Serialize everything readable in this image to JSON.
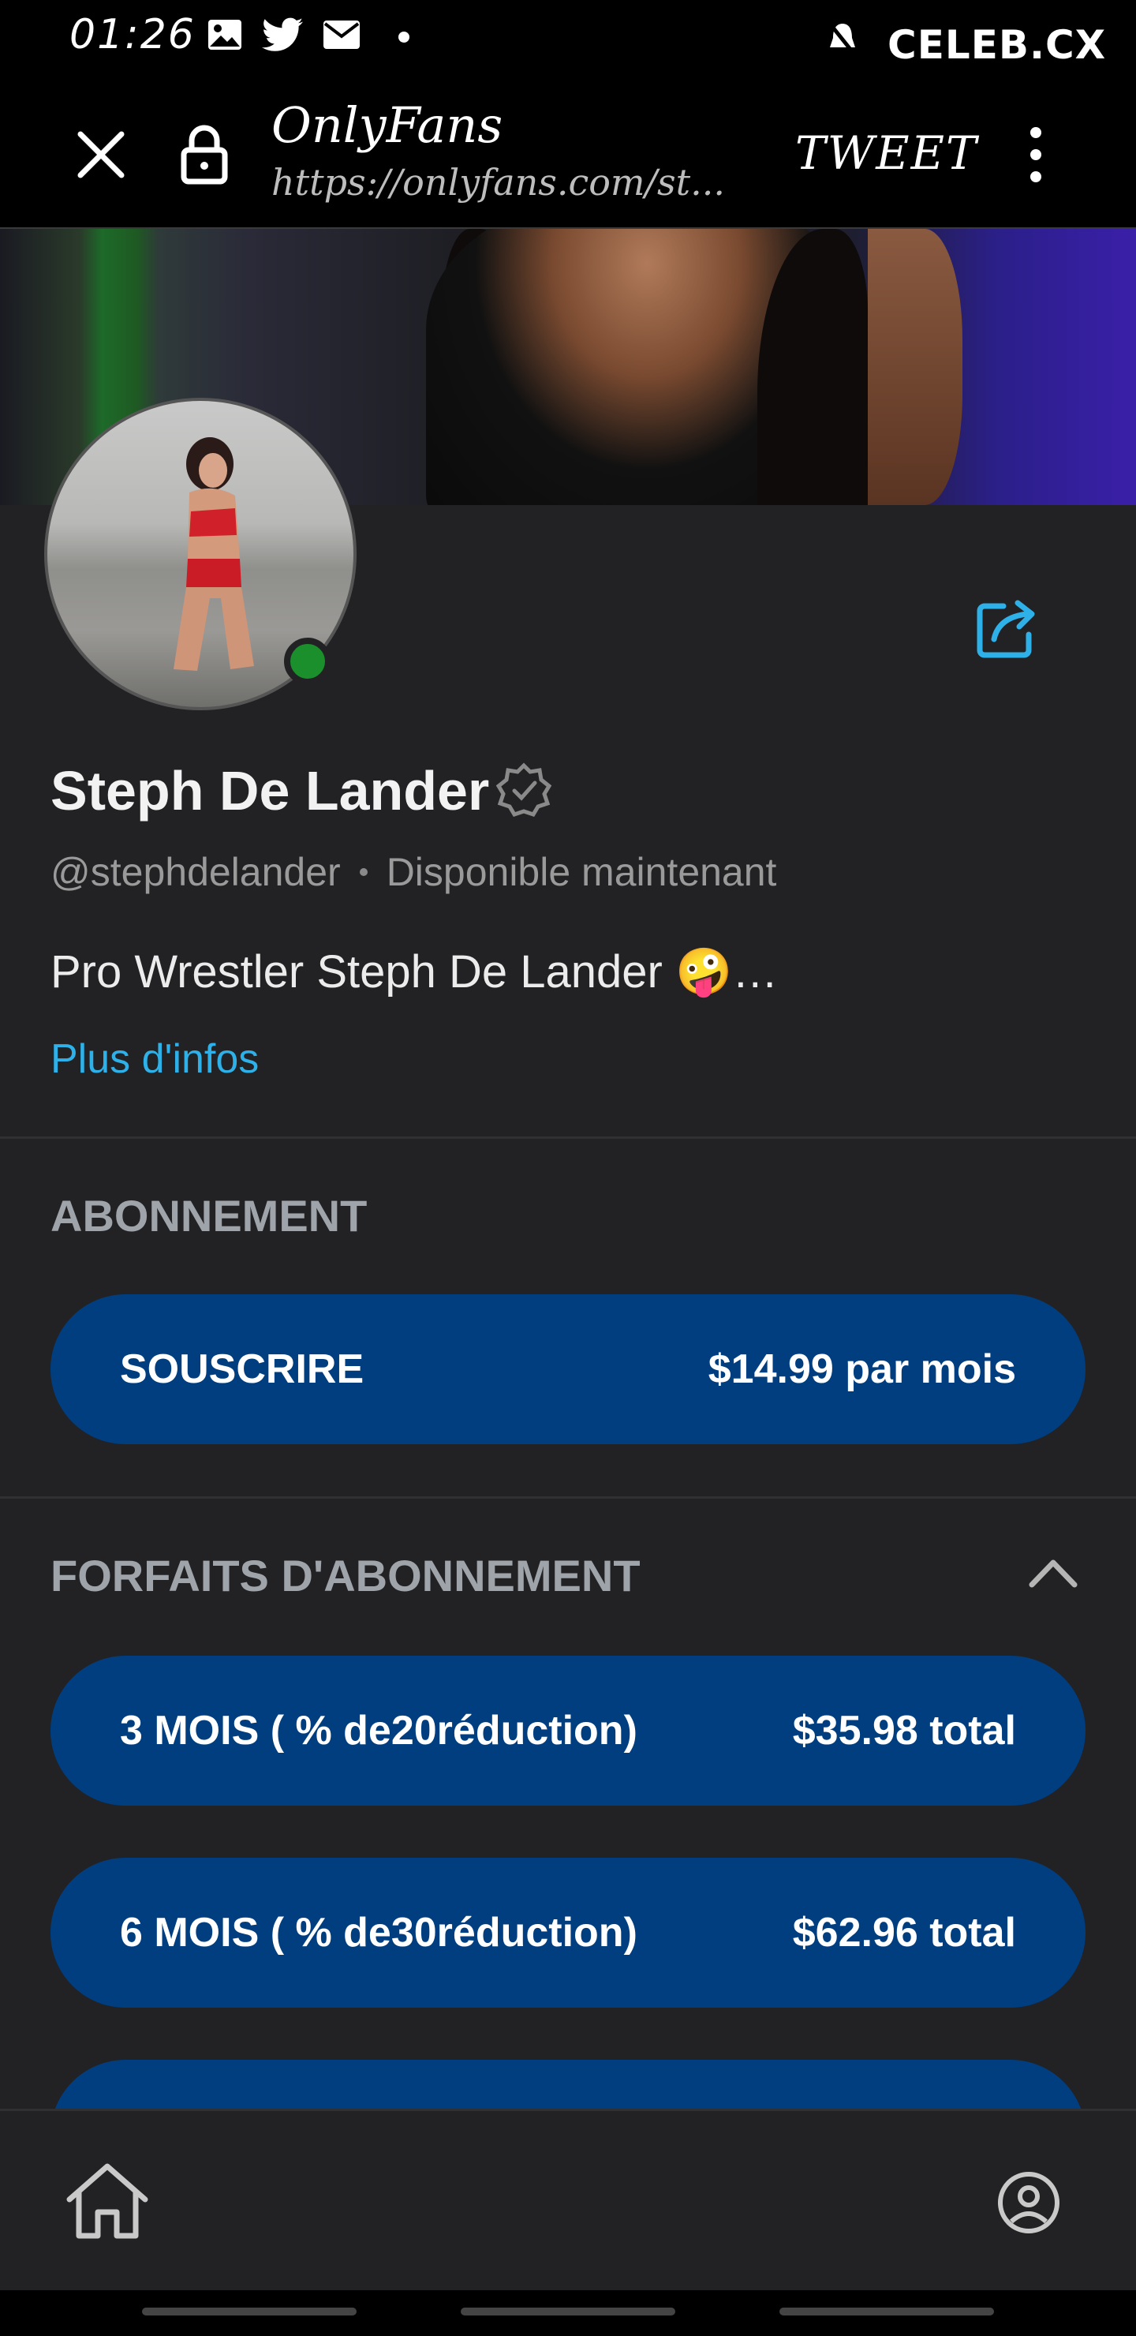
{
  "status_bar": {
    "time": "01:26",
    "icons": [
      "image-icon",
      "twitter-icon",
      "mail-icon",
      "dot-icon"
    ],
    "right_icon": "silent-icon",
    "watermark": "CELEB.CX"
  },
  "browser": {
    "title": "OnlyFans",
    "url": "https://onlyfans.com/st...",
    "action_label": "TWEET",
    "icons": [
      "close-icon",
      "lock-icon",
      "more-vert-icon"
    ]
  },
  "profile": {
    "name": "Steph De Lander",
    "handle": "@stephdelander",
    "availability": "Disponible maintenant",
    "bio": "Pro Wrestler Steph De Lander 🤪…",
    "more_link": "Plus d'infos",
    "online": true
  },
  "subscription": {
    "section_title": "ABONNEMENT",
    "subscribe_label": "SOUSCRIRE",
    "subscribe_price": "$14.99 par mois"
  },
  "bundles": {
    "section_title": "FORFAITS D'ABONNEMENT",
    "items": [
      {
        "label": "3 MOIS ( % de20réduction)",
        "price": "$35.98 total"
      },
      {
        "label": "6 MOIS ( % de30réduction)",
        "price": "$62.96 total"
      }
    ]
  },
  "colors": {
    "background": "#222224",
    "pill": "#003e80",
    "link": "#2eb0e8",
    "online": "#1a8f2c"
  }
}
